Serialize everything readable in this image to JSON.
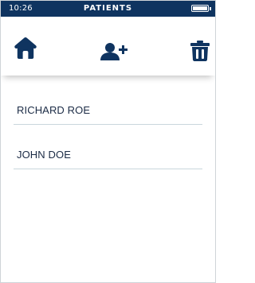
{
  "status": {
    "time": "10:26",
    "screen_title": "PATIENTS",
    "battery_icon": "battery-full-icon"
  },
  "toolbar": {
    "home_icon": "home-icon",
    "add_icon": "add-user-icon",
    "delete_icon": "trash-icon"
  },
  "patients": [
    {
      "name": "RICHARD ROE"
    },
    {
      "name": "JOHN DOE"
    }
  ],
  "colors": {
    "status_bar": "#0f3460",
    "icon": "#0f3460",
    "divider": "#c9d6dc",
    "text": "#1b2b45"
  }
}
